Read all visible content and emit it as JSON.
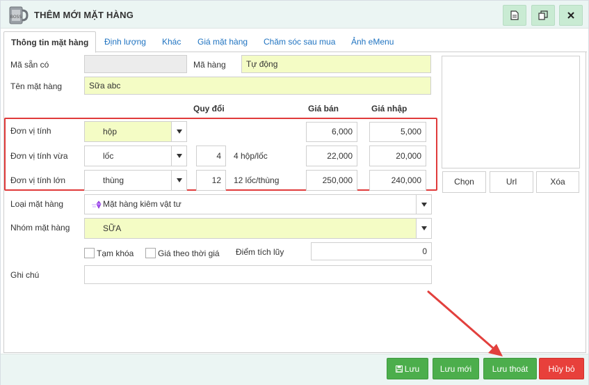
{
  "window": {
    "title": "THÊM MỚI MẶT HÀNG"
  },
  "tabs": [
    {
      "label": "Thông tin mặt hàng",
      "active": true
    },
    {
      "label": "Định lượng"
    },
    {
      "label": "Khác"
    },
    {
      "label": "Giá mặt hàng"
    },
    {
      "label": "Chăm sóc sau mua"
    },
    {
      "label": "Ảnh eMenu"
    }
  ],
  "form": {
    "ma_san_co_label": "Mã sẵn có",
    "ma_san_co_value": "",
    "ma_hang_label": "Mã hàng",
    "ma_hang_value": "Tự động",
    "ten_mat_hang_label": "Tên mặt hàng",
    "ten_mat_hang_value": "Sữa abc",
    "headers": {
      "quy_doi": "Quy đổi",
      "gia_ban": "Giá bán",
      "gia_nhap": "Giá nhập"
    },
    "units": [
      {
        "label": "Đơn vị tính",
        "unit": "hộp",
        "conversion": "",
        "conversion_text": "",
        "gia_ban": "6,000",
        "gia_nhap": "5,000"
      },
      {
        "label": "Đơn vị tính vừa",
        "unit": "lốc",
        "conversion": "4",
        "conversion_text": "4 hộp/lốc",
        "gia_ban": "22,000",
        "gia_nhap": "20,000"
      },
      {
        "label": "Đơn vị tính lớn",
        "unit": "thùng",
        "conversion": "12",
        "conversion_text": "12 lốc/thùng",
        "gia_ban": "250,000",
        "gia_nhap": "240,000"
      }
    ],
    "loai_mat_hang_label": "Loại mặt hàng",
    "loai_mat_hang_value": "Mặt hàng kiêm vật tư",
    "nhom_mat_hang_label": "Nhóm mặt hàng",
    "nhom_mat_hang_value": "SỮA",
    "tam_khoa_label": "Tạm khóa",
    "tam_khoa_checked": false,
    "gia_theo_thoi_gia_label": "Giá theo thời giá",
    "gia_theo_thoi_gia_checked": false,
    "diem_tich_luy_label": "Điểm tích lũy",
    "diem_tich_luy_value": "0",
    "ghi_chu_label": "Ghi chú",
    "ghi_chu_value": ""
  },
  "image_panel": {
    "chon_label": "Chọn",
    "url_label": "Url",
    "xoa_label": "Xóa"
  },
  "footer": {
    "luu_label": "Lưu",
    "luu_moi_label": "Lưu mới",
    "luu_thoat_label": "Lưu thoát",
    "huy_bo_label": "Hủy bỏ"
  },
  "icons": {
    "title": "product-box-icon",
    "toolbar": [
      "document-icon",
      "copy-icon",
      "close-icon"
    ],
    "save": "floppy-disk-icon",
    "category": "gem-icon"
  },
  "colors": {
    "header_bg": "#ebf5f3",
    "input_yellow": "#f4fcc5",
    "button_green": "#4cae4c",
    "button_red": "#e8403b",
    "annotation_red": "#e03a3a",
    "tab_link": "#1f73c1"
  }
}
